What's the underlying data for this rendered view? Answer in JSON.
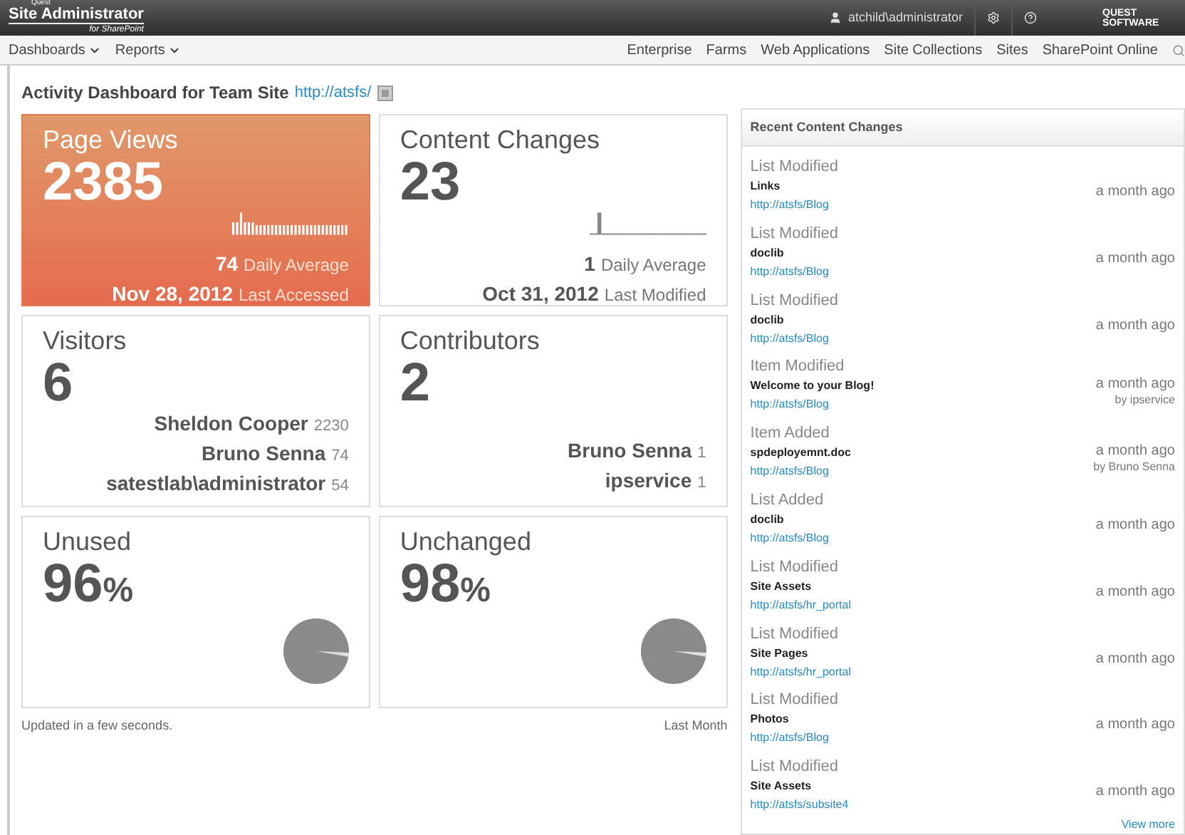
{
  "header": {
    "logo_small": "Quest",
    "logo": "Site Administrator",
    "logo_sub": "for SharePoint",
    "user": "atchild\\administrator",
    "brand": "QUEST SOFTWARE"
  },
  "nav": {
    "left": [
      {
        "label": "Dashboards"
      },
      {
        "label": "Reports"
      }
    ],
    "right": [
      "Enterprise",
      "Farms",
      "Web Applications",
      "Site Collections",
      "Sites",
      "SharePoint Online"
    ]
  },
  "page": {
    "title": "Activity Dashboard for Team Site",
    "url": "http://atsfs/"
  },
  "cards": [
    {
      "kind": "stat",
      "highlighted": true,
      "title": "Page Views",
      "value": "2385",
      "avg": "74",
      "avg_label": "Daily Average",
      "date": "Nov 28, 2012",
      "date_label": "Last Accessed"
    },
    {
      "kind": "stat",
      "highlighted": false,
      "title": "Content Changes",
      "value": "23",
      "avg": "1",
      "avg_label": "Daily Average",
      "date": "Oct 31, 2012",
      "date_label": "Last Modified"
    },
    {
      "kind": "people",
      "highlighted": false,
      "title": "Visitors",
      "value": "6",
      "people": [
        {
          "name": "Sheldon Cooper",
          "count": "2230"
        },
        {
          "name": "Bruno Senna",
          "count": "74"
        },
        {
          "name": "satestlab\\administrator",
          "count": "54"
        }
      ]
    },
    {
      "kind": "people",
      "highlighted": false,
      "title": "Contributors",
      "value": "2",
      "people": [
        {
          "name": "Bruno Senna",
          "count": "1"
        },
        {
          "name": "ipservice",
          "count": "1"
        }
      ]
    },
    {
      "kind": "percent",
      "highlighted": false,
      "title": "Unused",
      "value": "96",
      "unit": "%"
    },
    {
      "kind": "percent",
      "highlighted": false,
      "title": "Unchanged",
      "value": "98",
      "unit": "%"
    }
  ],
  "footer": {
    "updated": "Updated in a few seconds.",
    "period": "Last Month"
  },
  "recent": {
    "title": "Recent Content Changes",
    "items": [
      {
        "action": "List Modified",
        "name": "Links",
        "url": "http://atsfs/Blog",
        "time": "a month ago"
      },
      {
        "action": "List Modified",
        "name": "doclib",
        "url": "http://atsfs/Blog",
        "time": "a month ago"
      },
      {
        "action": "List Modified",
        "name": "doclib",
        "url": "http://atsfs/Blog",
        "time": "a month ago"
      },
      {
        "action": "Item Modified",
        "name": "Welcome to your Blog!",
        "url": "http://atsfs/Blog",
        "time": "a month ago",
        "by": "by ipservice"
      },
      {
        "action": "Item Added",
        "name": "spdeployemnt.doc",
        "url": "http://atsfs/Blog",
        "time": "a month ago",
        "by": "by Bruno Senna"
      },
      {
        "action": "List Added",
        "name": "doclib",
        "url": "http://atsfs/Blog",
        "time": "a month ago"
      },
      {
        "action": "List Modified",
        "name": "Site Assets",
        "url": "http://atsfs/hr_portal",
        "time": "a month ago"
      },
      {
        "action": "List Modified",
        "name": "Site Pages",
        "url": "http://atsfs/hr_portal",
        "time": "a month ago"
      },
      {
        "action": "List Modified",
        "name": "Photos",
        "url": "http://atsfs/Blog",
        "time": "a month ago"
      },
      {
        "action": "List Modified",
        "name": "Site Assets",
        "url": "http://atsfs/subsite4",
        "time": "a month ago"
      }
    ],
    "more": "View more"
  }
}
